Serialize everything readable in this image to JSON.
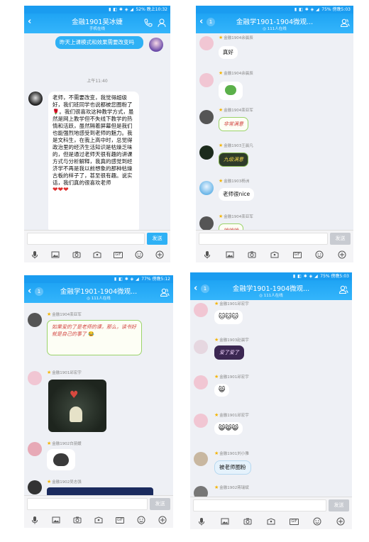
{
  "colors": {
    "titlebar": "#1fa4f4",
    "send_active": "#2fb1f5",
    "send_inactive": "#c8cbd1",
    "bubble_self": "#2fb1f5"
  },
  "phone1": {
    "status": "52%  晚上10:32",
    "title": "金融1901吴冰婕",
    "subtitle": "手机在线",
    "self_msg": "昨天上课模式和效果需要改变吗",
    "time": "上午11:40",
    "reply_p1": "老师，不需要改变，我觉得超级好，我们班同学也说都被您圈粉了",
    "reply_p2": "。我们很喜欢这种教学方式，虽然是网上教学但不失线下教学的热情和活跃，虽然隔着屏幕但是我们也能强烈地感受到老师的魅力。我是文科生，在我上高中时，总觉得政治里的经济生活知识是枯燥乏味的，但是通过老师天很有趣的讲课方式与分析解释，我真的感觉到经济学不再是我以前想象的那种枯燥古板的样子了，甚至很有趣。说实话，我们真的很喜欢老师",
    "send": "发送"
  },
  "phone2": {
    "status": "75%  傍晚5:03",
    "badge": "1",
    "title": "金融学1901-1904微观...",
    "subtitle": "111人在线",
    "n0": "金融1904余晨辰",
    "b0": "真好",
    "n1": "金融1904余晨辰",
    "n2": "金融1904栾亚军",
    "d2": "非常满意",
    "n3": "金融1903王晨凡",
    "d3": "九级满意",
    "n4": "金融1903杨洲",
    "b4": "老师很nice",
    "n5": "金融1904栾亚军",
    "d5": "哈哈哈",
    "send": "发送"
  },
  "phone3": {
    "status": "77%  傍晚5:12",
    "badge": "1",
    "title": "金融学1901-1904微观...",
    "subtitle": "111人在线",
    "n1": "金融1904栾亚军",
    "d1": "如果爱的了是老师的课，那么，读书好就是自己的事了",
    "n2": "金融1901邱宏宇",
    "n3": "金融1902白丽媛",
    "n4": "金融1902吴志强",
    "send": "发送"
  },
  "phone4": {
    "status": "75%  傍晚5:03",
    "badge": "1",
    "title": "金融学1901-1904微观...",
    "subtitle": "111人在线",
    "n1": "金融1901邱宏宇",
    "n2": "金融1903赵晨宇",
    "d2": "爱了爱了",
    "n3": "金融1901邱宏宇",
    "n4": "金融1901邱宏宇",
    "n5": "金融1901刘小雅",
    "b5": "被老师圈粉",
    "n6": "金融1902蒋瑞斌",
    "send": "发送"
  }
}
